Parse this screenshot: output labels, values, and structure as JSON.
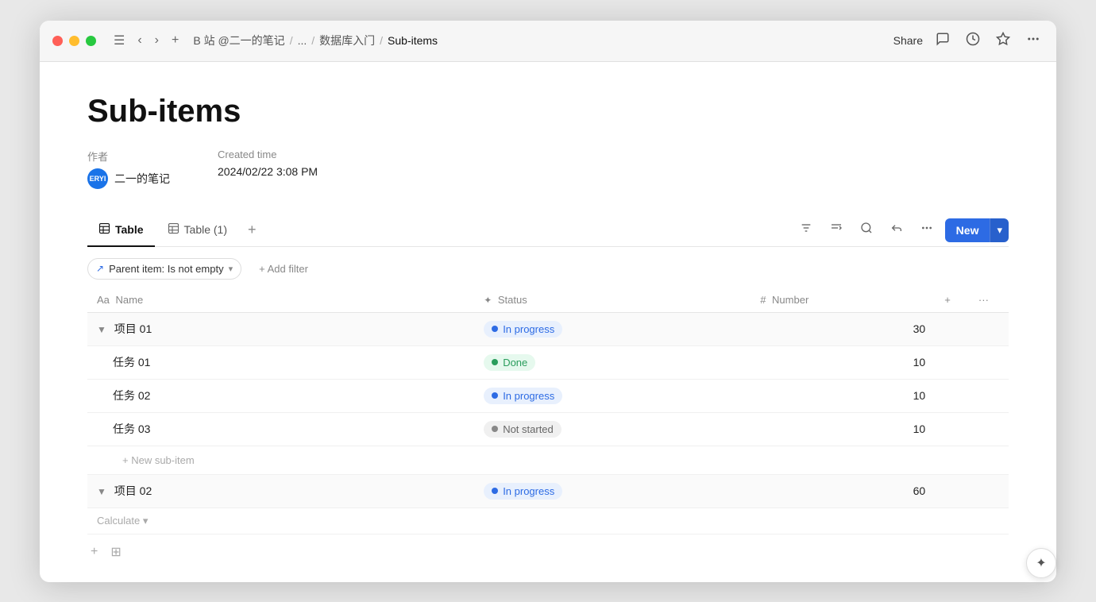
{
  "window": {
    "title": "Sub-items"
  },
  "titlebar": {
    "menu_icon": "☰",
    "back_icon": "‹",
    "forward_icon": "›",
    "add_icon": "+",
    "breadcrumb": [
      {
        "label": "B 站 @二一的笔记",
        "id": "bc1"
      },
      {
        "label": "...",
        "id": "bc2"
      },
      {
        "label": "数据库入门",
        "id": "bc3"
      },
      {
        "label": "Sub-items",
        "id": "bc4"
      }
    ],
    "share_label": "Share",
    "comment_icon": "💬",
    "history_icon": "🕐",
    "star_icon": "☆",
    "more_icon": "···"
  },
  "page": {
    "title": "Sub-items",
    "meta": {
      "author_label": "作者",
      "author_avatar": "ERYI",
      "author_name": "二一的笔记",
      "created_label": "Created time",
      "created_value": "2024/02/22 3:08 PM"
    }
  },
  "tabs": [
    {
      "id": "tab1",
      "label": "Table",
      "active": true
    },
    {
      "id": "tab2",
      "label": "Table (1)",
      "active": false
    }
  ],
  "toolbar": {
    "filter_icon": "≡",
    "sort_icon": "⇅",
    "search_icon": "🔍",
    "sub_icon": "⤵",
    "more_icon": "···",
    "new_label": "New",
    "new_arrow": "▾"
  },
  "filter": {
    "chip_icon": "↗",
    "chip_label": "Parent item: Is not empty",
    "chip_arrow": "▾",
    "add_label": "+ Add filter"
  },
  "table": {
    "columns": [
      {
        "id": "name",
        "label": "Name",
        "icon": "Aa"
      },
      {
        "id": "status",
        "label": "Status",
        "icon": "✦"
      },
      {
        "id": "number",
        "label": "Number",
        "icon": "#"
      }
    ],
    "rows": [
      {
        "id": "row1",
        "type": "parent",
        "name": "项目 01",
        "status": "In progress",
        "status_type": "in-progress",
        "number": "30"
      },
      {
        "id": "row2",
        "type": "child",
        "name": "任务 01",
        "status": "Done",
        "status_type": "done",
        "number": "10"
      },
      {
        "id": "row3",
        "type": "child",
        "name": "任务 02",
        "status": "In progress",
        "status_type": "in-progress",
        "number": "10"
      },
      {
        "id": "row4",
        "type": "child",
        "name": "任务 03",
        "status": "Not started",
        "status_type": "not-started",
        "number": "10"
      },
      {
        "id": "row5",
        "type": "new-subitem",
        "label": "+ New sub-item"
      },
      {
        "id": "row6",
        "type": "parent",
        "name": "项目 02",
        "status": "In progress",
        "status_type": "in-progress",
        "number": "60"
      }
    ],
    "calculate_label": "Calculate",
    "calculate_arrow": "▾"
  },
  "bottom": {
    "add_icon": "+",
    "grid_icon": "⊞"
  },
  "ai_button": {
    "icon": "✦"
  }
}
